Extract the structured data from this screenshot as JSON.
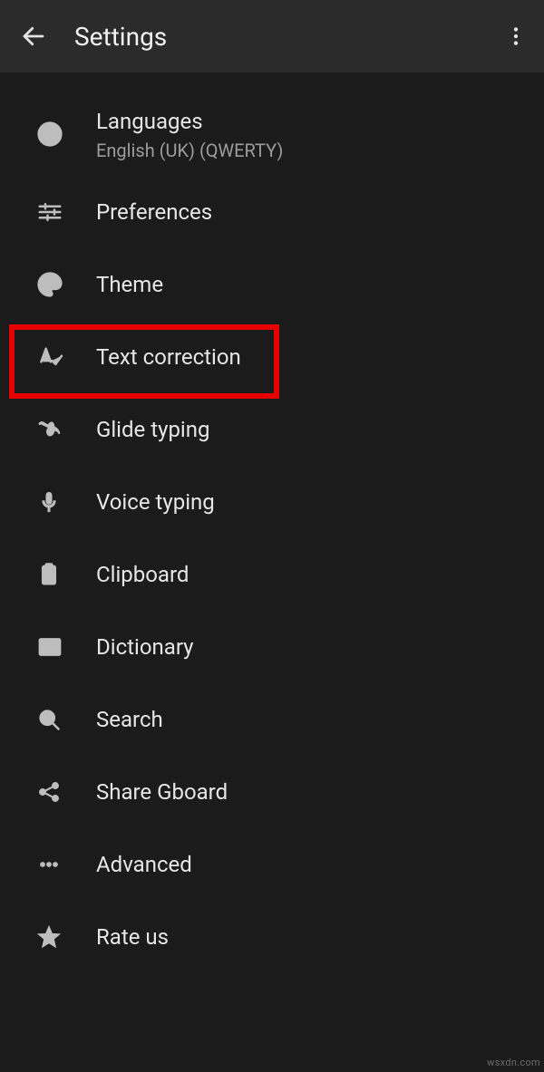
{
  "header": {
    "title": "Settings"
  },
  "items": [
    {
      "label": "Languages",
      "sub": "English (UK) (QWERTY)"
    },
    {
      "label": "Preferences"
    },
    {
      "label": "Theme"
    },
    {
      "label": "Text correction"
    },
    {
      "label": "Glide typing"
    },
    {
      "label": "Voice typing"
    },
    {
      "label": "Clipboard"
    },
    {
      "label": "Dictionary"
    },
    {
      "label": "Search"
    },
    {
      "label": "Share Gboard"
    },
    {
      "label": "Advanced"
    },
    {
      "label": "Rate us"
    }
  ],
  "watermark": "wsxdn.com"
}
